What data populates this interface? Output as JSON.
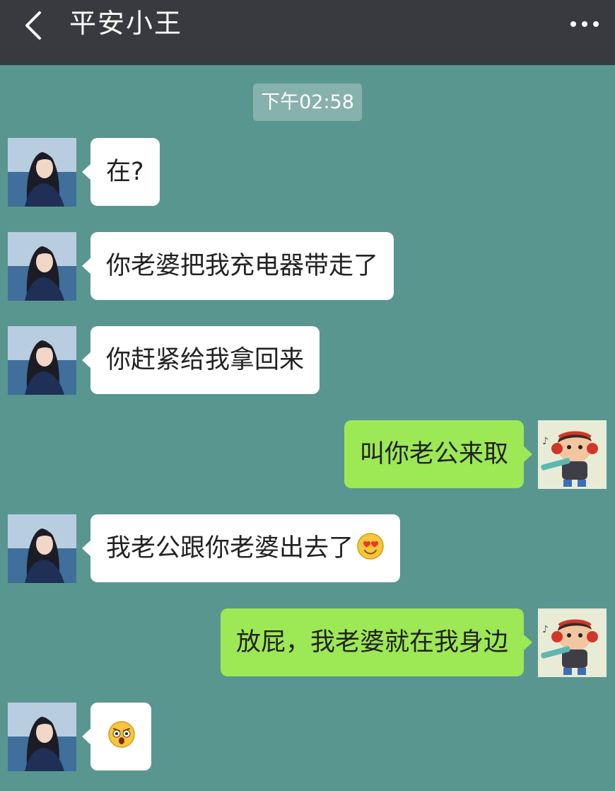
{
  "header": {
    "title": "平安小王",
    "back_icon": "chevron-left-icon",
    "more_icon": "more-dots-icon"
  },
  "chat": {
    "timestamp": "下午02:58",
    "messages": [
      {
        "side": "left",
        "text": "在?",
        "emoji": ""
      },
      {
        "side": "left",
        "text": "你老婆把我充电器带走了",
        "emoji": ""
      },
      {
        "side": "left",
        "text": "你赶紧给我拿回来",
        "emoji": ""
      },
      {
        "side": "right",
        "text": "叫你老公来取",
        "emoji": ""
      },
      {
        "side": "left",
        "text": "我老公跟你老婆出去了",
        "emoji": "heart-eyes-emoji"
      },
      {
        "side": "right",
        "text": "放屁，我老婆就在我身边",
        "emoji": ""
      },
      {
        "side": "left",
        "text": "",
        "emoji": "shocked-face-emoji"
      }
    ]
  },
  "colors": {
    "topbar": "#393a3f",
    "chat_background": "#5a9690",
    "received_bubble": "#ffffff",
    "sent_bubble": "#9de855"
  }
}
